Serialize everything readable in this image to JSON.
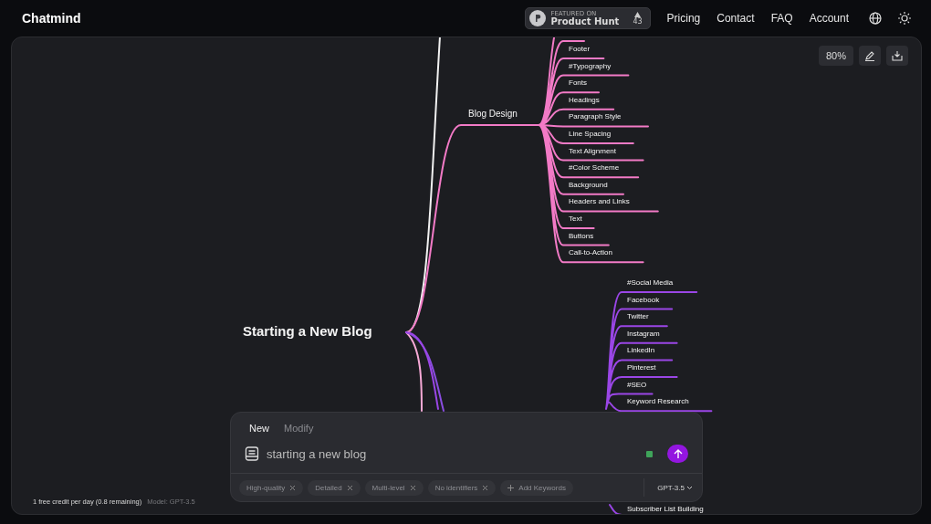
{
  "header": {
    "logo": "Chatmind",
    "badge": {
      "caption": "FEATURED ON",
      "title": "Product Hunt",
      "count": "43"
    },
    "nav": [
      "Pricing",
      "Contact",
      "FAQ",
      "Account"
    ]
  },
  "toolbar": {
    "zoom": "80%"
  },
  "mindmap": {
    "root": "Starting a New Blog",
    "branches": [
      {
        "label": "Blog Design",
        "color": "#f27ac6",
        "children": [
          "Footer",
          "#Typography",
          "Fonts",
          "Headings",
          "Paragraph Style",
          "Line Spacing",
          "Text Alignment",
          "#Color Scheme",
          "Background",
          "Headers and Links",
          "Text",
          "Buttons",
          "Call-to-Action"
        ]
      },
      {
        "color": "#9a46e6",
        "children": [
          "#Social Media",
          "Facebook",
          "Twitter",
          "Instagram",
          "LinkedIn",
          "Pinterest",
          "#SEO",
          "Keyword Research"
        ],
        "trailing_child": "Subscriber List Building"
      }
    ]
  },
  "prompt": {
    "tabs": [
      {
        "label": "New",
        "selected": true
      },
      {
        "label": "Modify",
        "selected": false
      }
    ],
    "value": "starting a new blog",
    "tags": [
      "High-quality",
      "Detailed",
      "Multi-level",
      "No identifiers"
    ],
    "add_keywords": "Add Keywords",
    "model": "GPT-3.5"
  },
  "footer": {
    "credits": "1 free credit per day (0.8 remaining)",
    "model": "Model: GPT-3.5"
  }
}
